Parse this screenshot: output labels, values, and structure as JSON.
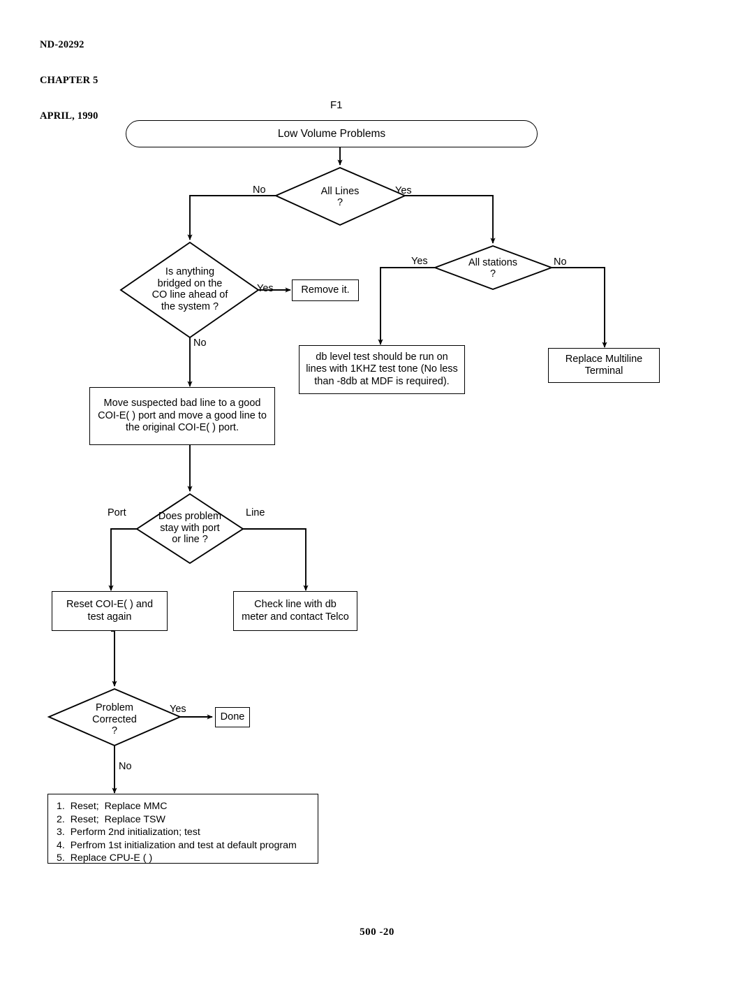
{
  "document": {
    "header_lines": [
      "ND-20292",
      "CHAPTER 5",
      "APRIL, 1990"
    ],
    "footer": "500 -20"
  },
  "figure": {
    "caption": "F1"
  },
  "chart_data": {
    "type": "diagram",
    "title": "Low Volume Problems",
    "nodes": [
      {
        "id": "start",
        "shape": "terminator",
        "text": "Low Volume Problems"
      },
      {
        "id": "all_lines",
        "shape": "decision",
        "text": "All Lines\n?"
      },
      {
        "id": "bridged",
        "shape": "decision",
        "text": "Is anything\nbridged on the\nCO line ahead of\nthe system ?"
      },
      {
        "id": "remove_it",
        "shape": "process",
        "text": "Remove it."
      },
      {
        "id": "all_stations",
        "shape": "decision",
        "text": "All stations\n?"
      },
      {
        "id": "db_level",
        "shape": "process",
        "text": "db level test should be run on lines with 1KHZ test tone  (No less than -8db at MDF is required)."
      },
      {
        "id": "replace_mlt",
        "shape": "process",
        "text": "Replace Multiline Terminal"
      },
      {
        "id": "move_line",
        "shape": "process",
        "text": "Move suspected bad line to a good COI-E( ) port and move a good line to the original COI-E( ) port."
      },
      {
        "id": "port_or_line",
        "shape": "decision",
        "text": "Does problem\nstay with port\nor line ?"
      },
      {
        "id": "reset_coi",
        "shape": "process",
        "text": "Reset COI-E( ) and test again"
      },
      {
        "id": "check_line",
        "shape": "process",
        "text": "Check line with db meter and contact Telco"
      },
      {
        "id": "corrected",
        "shape": "decision",
        "text": "Problem\nCorrected\n?"
      },
      {
        "id": "done",
        "shape": "process",
        "text": "Done"
      },
      {
        "id": "steps",
        "shape": "process",
        "text": "numbered remedy list"
      }
    ],
    "edges": [
      {
        "from": "start",
        "to": "all_lines",
        "label": ""
      },
      {
        "from": "all_lines",
        "to": "bridged",
        "label": "No"
      },
      {
        "from": "all_lines",
        "to": "all_stations",
        "label": "Yes"
      },
      {
        "from": "bridged",
        "to": "remove_it",
        "label": "Yes"
      },
      {
        "from": "bridged",
        "to": "move_line",
        "label": "No"
      },
      {
        "from": "all_stations",
        "to": "db_level",
        "label": "Yes"
      },
      {
        "from": "all_stations",
        "to": "replace_mlt",
        "label": "No"
      },
      {
        "from": "move_line",
        "to": "port_or_line",
        "label": ""
      },
      {
        "from": "port_or_line",
        "to": "reset_coi",
        "label": "Port"
      },
      {
        "from": "port_or_line",
        "to": "check_line",
        "label": "Line"
      },
      {
        "from": "reset_coi",
        "to": "corrected",
        "label": ""
      },
      {
        "from": "corrected",
        "to": "done",
        "label": "Yes"
      },
      {
        "from": "corrected",
        "to": "steps",
        "label": "No"
      }
    ]
  },
  "nodes": {
    "start": {
      "text": "Low Volume Problems"
    },
    "all_lines": {
      "line1": "All Lines",
      "line2": "?"
    },
    "bridged": {
      "line1": "Is anything",
      "line2": "bridged on the",
      "line3": "CO line ahead of",
      "line4": "the system ?"
    },
    "remove_it": {
      "text": "Remove it."
    },
    "all_stations": {
      "line1": "All stations",
      "line2": "?"
    },
    "db_level": {
      "line1": "db level test should be run on",
      "line2": "lines with 1KHZ test tone  (No less",
      "line3": "than -8db at MDF is required)."
    },
    "replace_mlt": {
      "line1": "Replace Multiline",
      "line2": "Terminal"
    },
    "move_line": {
      "line1": "Move suspected bad line to a good",
      "line2": "COI-E( ) port and move a good line to",
      "line3": "the original COI-E( ) port."
    },
    "port_or_line": {
      "line1": "Does problem",
      "line2": "stay with port",
      "line3": "or line ?"
    },
    "reset_coi": {
      "line1": "Reset COI-E( ) and",
      "line2": "test again"
    },
    "check_line": {
      "line1": "Check line with db",
      "line2": "meter and contact Telco"
    },
    "corrected": {
      "line1": "Problem",
      "line2": "Corrected",
      "line3": "?"
    },
    "done": {
      "text": "Done"
    }
  },
  "edge_labels": {
    "all_lines_no": "No",
    "all_lines_yes": "Yes",
    "bridged_yes": "Yes",
    "bridged_no": "No",
    "stations_yes": "Yes",
    "stations_no": "No",
    "port": "Port",
    "line": "Line",
    "corrected_yes": "Yes",
    "corrected_no": "No"
  },
  "steps_box": {
    "items": [
      "1.  Reset;  Replace MMC",
      "2.  Reset;  Replace TSW",
      "3.  Perform 2nd initialization; test",
      "4.  Perfrom 1st initialization and test at default program",
      "5.  Replace CPU-E ( )"
    ]
  },
  "colors": {
    "ink": "#000000",
    "paper": "#ffffff"
  }
}
